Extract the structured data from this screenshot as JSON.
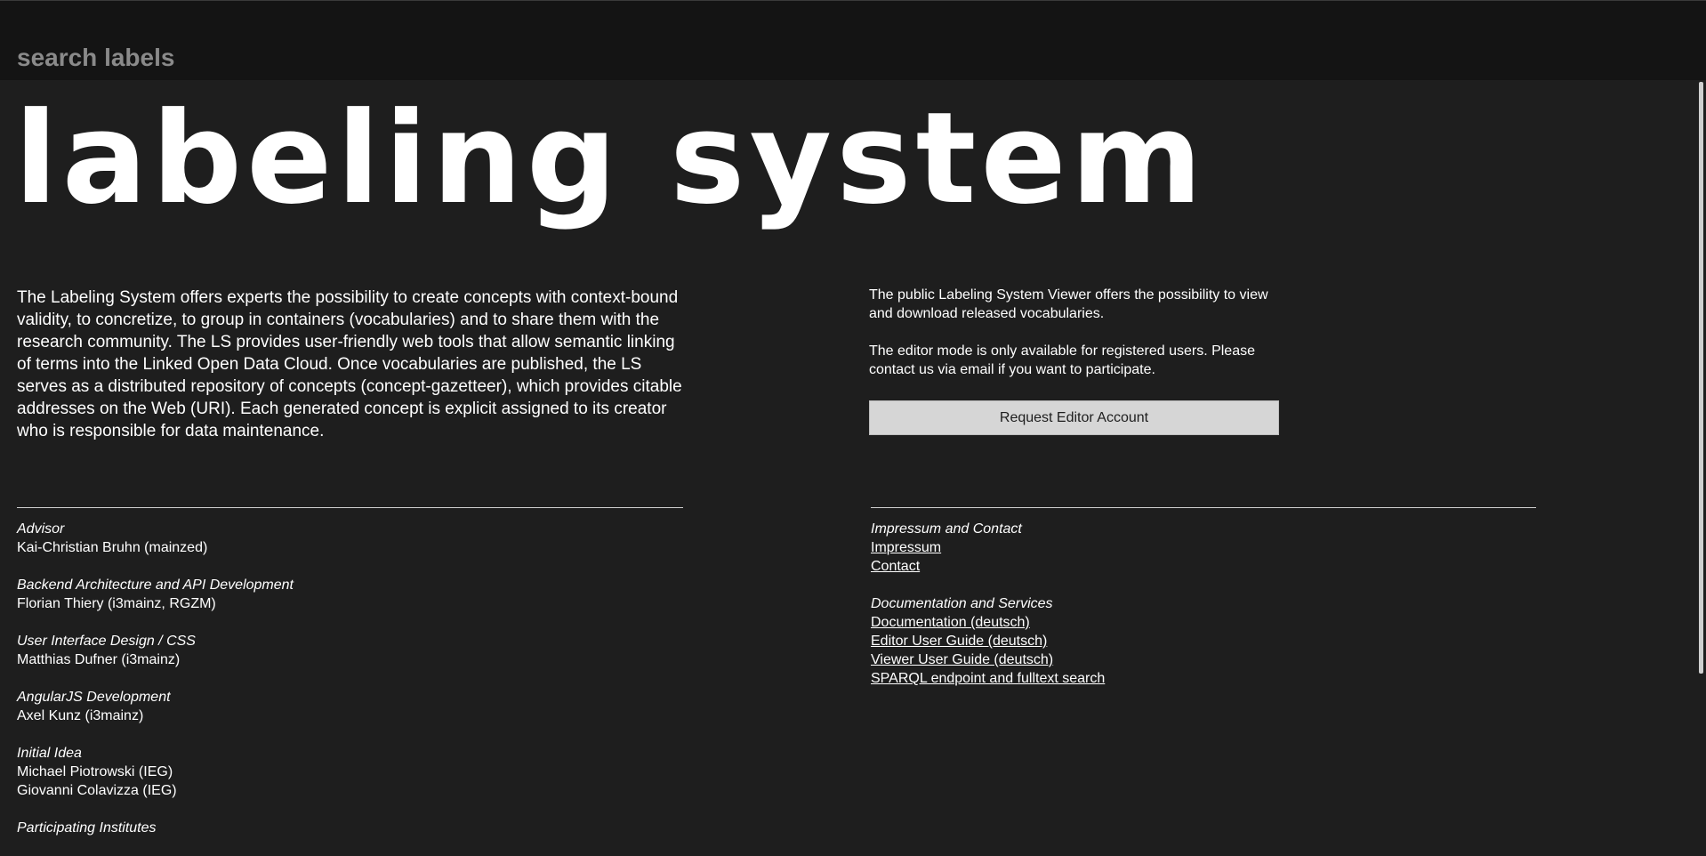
{
  "search": {
    "placeholder": "search labels"
  },
  "logo": {
    "text": "labeling system"
  },
  "intro": {
    "text": "The Labeling System offers experts the possibility to create concepts with context-bound validity, to concretize, to group in containers (vocabularies) and to share them with the research community. The LS provides user-friendly web tools that allow semantic linking of terms into the Linked Open Data Cloud. Once vocabularies are published, the LS serves as a distributed repository of concepts (concept-gazetteer), which provides citable addresses on the Web (URI). Each generated concept is explicit assigned to its creator who is responsible for data maintenance."
  },
  "viewer_info": {
    "paragraph1": "The public Labeling System Viewer offers the possibility to view and download released vocabularies.",
    "paragraph2": "The editor mode is only available for registered users. Please contact us via email if you want to participate.",
    "request_button_label": "Request Editor Account"
  },
  "credits": [
    {
      "title": "Advisor",
      "names": [
        "Kai-Christian Bruhn (mainzed)"
      ]
    },
    {
      "title": "Backend Architecture and API Development",
      "names": [
        "Florian Thiery (i3mainz, RGZM)"
      ]
    },
    {
      "title": "User Interface Design / CSS",
      "names": [
        "Matthias Dufner (i3mainz)"
      ]
    },
    {
      "title": "AngularJS Development",
      "names": [
        "Axel Kunz (i3mainz)"
      ]
    },
    {
      "title": "Initial Idea",
      "names": [
        "Michael Piotrowski (IEG)",
        "Giovanni Colavizza (IEG)"
      ]
    },
    {
      "title": "Participating Institutes",
      "names": []
    }
  ],
  "links": {
    "impressum_title": "Impressum and Contact",
    "impressum": "Impressum",
    "contact": "Contact",
    "docs_title": "Documentation and Services",
    "documentation": "Documentation (deutsch)",
    "editor_guide": "Editor User Guide (deutsch)",
    "viewer_guide": "Viewer User Guide (deutsch)",
    "sparql": "SPARQL endpoint and fulltext search"
  }
}
